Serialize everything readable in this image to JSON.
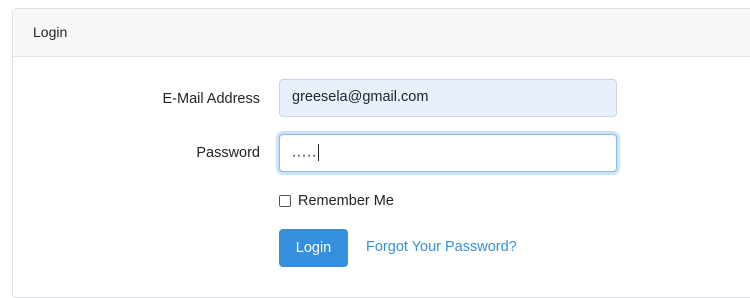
{
  "card": {
    "header_title": "Login"
  },
  "form": {
    "email_label": "E-Mail Address",
    "email_value": "greesela@gmail.com",
    "password_label": "Password",
    "password_masked": ".....",
    "remember_label": "Remember Me",
    "remember_checked": false,
    "login_button": "Login",
    "forgot_link": "Forgot Your Password?"
  },
  "colors": {
    "primary": "#3490dc",
    "autofill_bg": "#e8f0fe",
    "header_bg": "#f7f7f7"
  }
}
